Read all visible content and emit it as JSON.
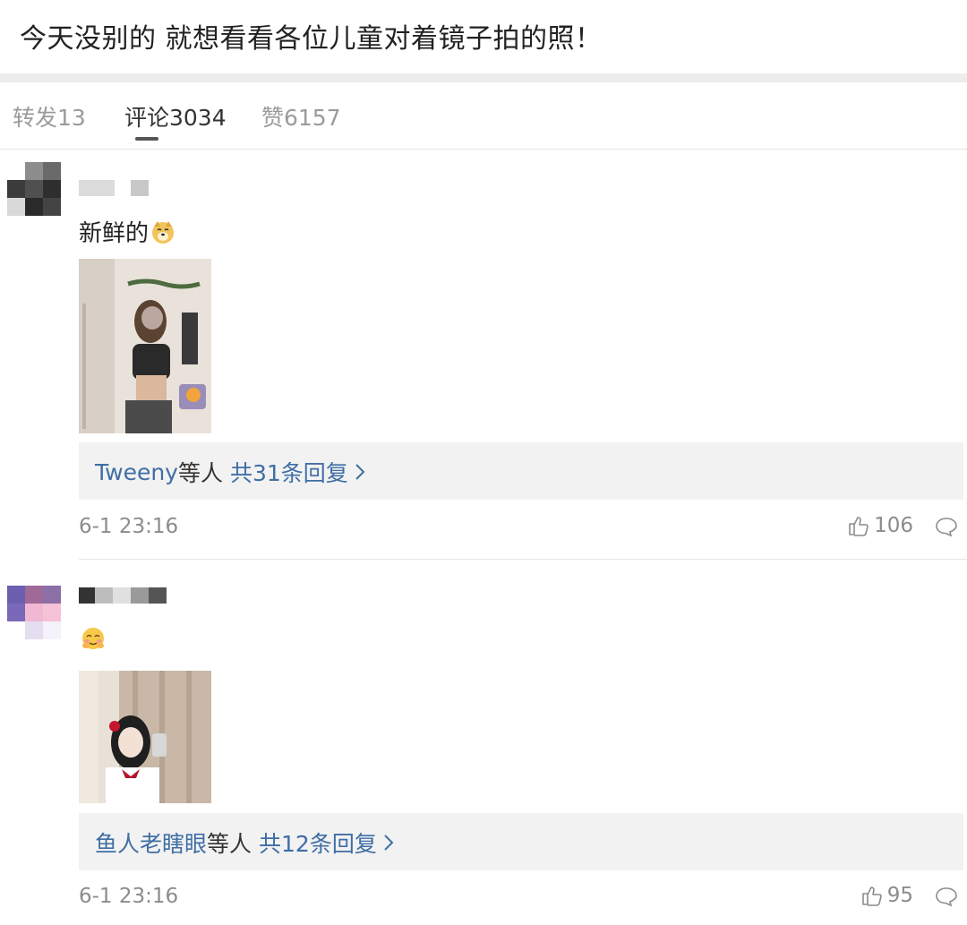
{
  "post": {
    "title": "今天没别的 就想看看各位儿童对着镜子拍的照！"
  },
  "tabs": [
    {
      "label": "转发13",
      "active": false
    },
    {
      "label": "评论3034",
      "active": true
    },
    {
      "label": "赞6157",
      "active": false
    }
  ],
  "comments": [
    {
      "text": "新鲜的",
      "emoji": "doge-emoji",
      "reply_users": "Tweeny",
      "reply_suffix": "等人",
      "reply_count_label": "共31条回复",
      "timestamp": "6-1 23:16",
      "likes": "106"
    },
    {
      "text": "",
      "emoji": "blush-emoji",
      "reply_users": "鱼人老瞎眼",
      "reply_suffix": "等人",
      "reply_count_label": "共12条回复",
      "timestamp": "6-1 23:16",
      "likes": "95"
    }
  ],
  "colors": {
    "link_blue": "#3f6ea5",
    "muted_gray": "#8c8c8c",
    "reply_bg": "#f2f2f2"
  }
}
